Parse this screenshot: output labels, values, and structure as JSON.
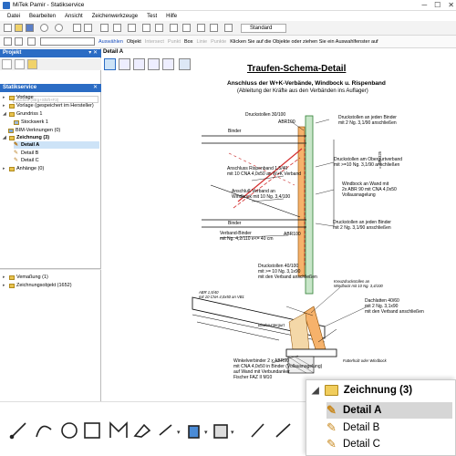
{
  "window": {
    "title": "MiTek Pamir - Statikservice"
  },
  "menu": [
    "Datei",
    "Bearbeiten",
    "Ansicht",
    "Zeichenwerkzeuge",
    "Test",
    "Hilfe"
  ],
  "toolbar": {
    "standard_select": "Standard"
  },
  "selection_bar": {
    "items": [
      "Auswählen",
      "Objekt",
      "Intersect",
      "Punkt",
      "Box",
      "Linie",
      "Punkte"
    ],
    "hint": "Klicken Sie auf die Objekte oder ziehen Sie ein Auswahlfenster auf"
  },
  "left_panel": {
    "project_header": "Projekt",
    "statik_header": "Statikservice",
    "search_placeholder": "Suchen (Strg+Shift+F3)",
    "tree": [
      {
        "label": "Vorlage"
      },
      {
        "label": "Vorlage (gespeichert im Hersteller)"
      },
      {
        "label": "Grundriss 1"
      },
      {
        "label": "Stockwerk 1"
      },
      {
        "label": "BIM-Verknungen (0)"
      },
      {
        "label": "Zeichnung (3)"
      },
      {
        "label": "Detail A"
      },
      {
        "label": "Detail B"
      },
      {
        "label": "Detail C"
      },
      {
        "label": "Anhänge (0)"
      }
    ],
    "lower_tree": [
      {
        "label": "Vemaßung (1)"
      },
      {
        "label": "Zeichnungsobjekt (1652)"
      }
    ]
  },
  "detail_tab": {
    "label": "Detail A"
  },
  "drawing": {
    "title": "Traufen-Schema-Detail",
    "subtitle": "Anschluss der W+K-Verbände, Windbock u. Rispenband",
    "subtitle2": "(Ableitung der Kräfte aus den Verbänden ins Auflager)",
    "labels": {
      "drucks1": "Druckstollen 30/100",
      "abr1": "ABR100",
      "binder1": "Binder",
      "drucks_r1": "Druckstollen an jeden Binder\nmit 2 Ng. 3,1/90 anschließen",
      "drucks_r2": "Druckstollen am Obergurtverband\nmit >=10 Ng. 3,1/90 anschließen",
      "rispen": "Anschluss Rispenband 1,5/40\nmit 10 CNA 4,0x50 an W+K Verband",
      "windbock_l": "Anschluß Verband an\nWindbock mit 10 Ng. 3,4/100",
      "windbock_r": "Windbock an Wand mit\n2x ABR 90 mit CNA 4,0x50\nVollausnagelung",
      "binder2": "Binder",
      "verband": "Verband-Binder\nmit Ng. 4,2/110 e<= 40 cm",
      "abr2": "ABR100",
      "drucks_r3": "Druckstollen an jeden Binder\nmit 2 Ng. 3,1/90 anschließen",
      "dim": "= 400-325",
      "drucks2": "Druckstollen 40/100\nmit >= 10 Ng. 3,1x90\nmit den Verband anschließen",
      "kreuz": "Kreuzdruckstollen an\nWindbock mit 10 Ng. 3,4/100",
      "abr_small": "ABR 1,5/40\nmit 10 CNA 4,0x50 an VB1",
      "dachlatten": "Dachlatten 40/60\nmit 2 Ng. 3,1x90\nmit den Verband anschließen",
      "binderuntergurt": "Binderuntergurt",
      "futterholz": "Futterholz oder Windbock",
      "winkel": "Winkelverbinder 2 x ABR90\nmit CNA 4,0x50 in Binder (Vollausnagelung)\nauf Wand mit Verbundanker\nFischer FAZ II M10"
    }
  },
  "popup": {
    "header": "Zeichnung (3)",
    "items": [
      "Detail A",
      "Detail B",
      "Detail C"
    ]
  }
}
